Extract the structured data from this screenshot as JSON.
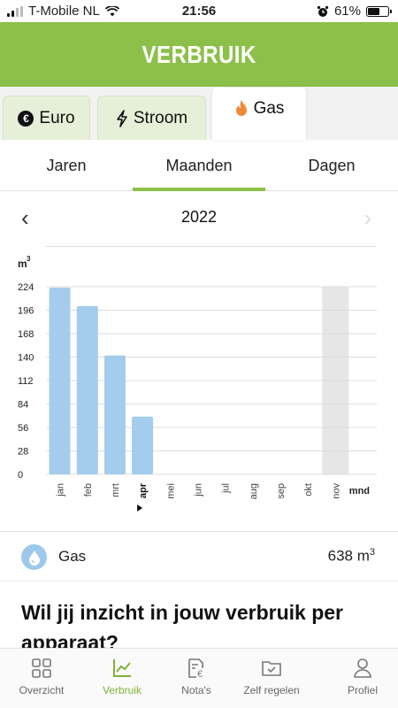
{
  "status": {
    "carrier": "T-Mobile NL",
    "time": "21:56",
    "battery": "61%",
    "battery_level": 0.61
  },
  "header": {
    "title": "VERBRUIK"
  },
  "energy_tabs": [
    {
      "label": "Euro",
      "icon": "euro-icon"
    },
    {
      "label": "Stroom",
      "icon": "lightning-icon"
    },
    {
      "label": "Gas",
      "icon": "flame-icon",
      "active": true
    }
  ],
  "period_tabs": {
    "jaren": "Jaren",
    "maanden": "Maanden",
    "dagen": "Dagen",
    "active": "Maanden"
  },
  "year_nav": {
    "year": "2022"
  },
  "chart_data": {
    "type": "bar",
    "unit": "m",
    "unit_sup": "3",
    "categories": [
      "jan",
      "feb",
      "mrt",
      "apr",
      "mei",
      "jun",
      "jul",
      "aug",
      "sep",
      "okt",
      "nov"
    ],
    "values": [
      223,
      201,
      142,
      69,
      null,
      null,
      null,
      null,
      null,
      null,
      null
    ],
    "y_ticks": [
      0,
      28,
      56,
      84,
      112,
      140,
      168,
      196,
      224
    ],
    "ylim": [
      0,
      224
    ],
    "current_month": "apr",
    "highlighted_category": "nov",
    "x_end_label": "mnd",
    "bar_color": "#a4ccec",
    "highlight_color": "#e6e6e6"
  },
  "summary": {
    "label": "Gas",
    "value": "638 m",
    "value_sup": "3",
    "icon": "water-drop-icon"
  },
  "promo": {
    "title": "Wil jij inzicht in jouw verbruik per apparaat?"
  },
  "bottom_nav": [
    {
      "label": "Overzicht",
      "icon": "grid-icon"
    },
    {
      "label": "Verbruik",
      "icon": "chart-icon",
      "active": true
    },
    {
      "label": "Nota's",
      "icon": "invoice-icon"
    },
    {
      "label": "Zelf regelen",
      "icon": "folder-check-icon"
    },
    {
      "label": "Profiel",
      "icon": "person-icon"
    }
  ],
  "colors": {
    "brand_green": "#8dc04a",
    "nav_active": "#7fb23a",
    "gas_orange": "#f08a3a",
    "bar_blue": "#a4ccec"
  }
}
